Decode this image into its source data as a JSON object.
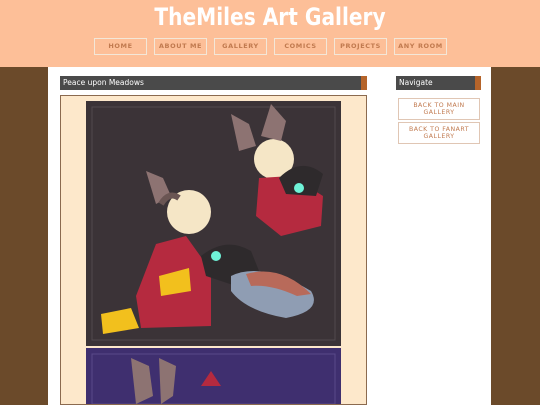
{
  "site": {
    "title": "TheMiles Art Gallery"
  },
  "nav": {
    "items": [
      {
        "label": "HOME"
      },
      {
        "label": "ABOUT ME"
      },
      {
        "label": "GALLERY"
      },
      {
        "label": "COMICS"
      },
      {
        "label": "PROJECTS"
      },
      {
        "label": "ANY ROOM"
      }
    ]
  },
  "post": {
    "title": "Peace upon Meadows"
  },
  "sidebar": {
    "title": "Navigate",
    "buttons": [
      {
        "label": "BACK TO MAIN GALLERY"
      },
      {
        "label": "BACK TO FANART GALLERY"
      }
    ]
  },
  "colors": {
    "header_bg": "#fdbf98",
    "page_bg": "#6b4a2a",
    "accent": "#b5642a",
    "nav_text": "#c17a4f"
  }
}
